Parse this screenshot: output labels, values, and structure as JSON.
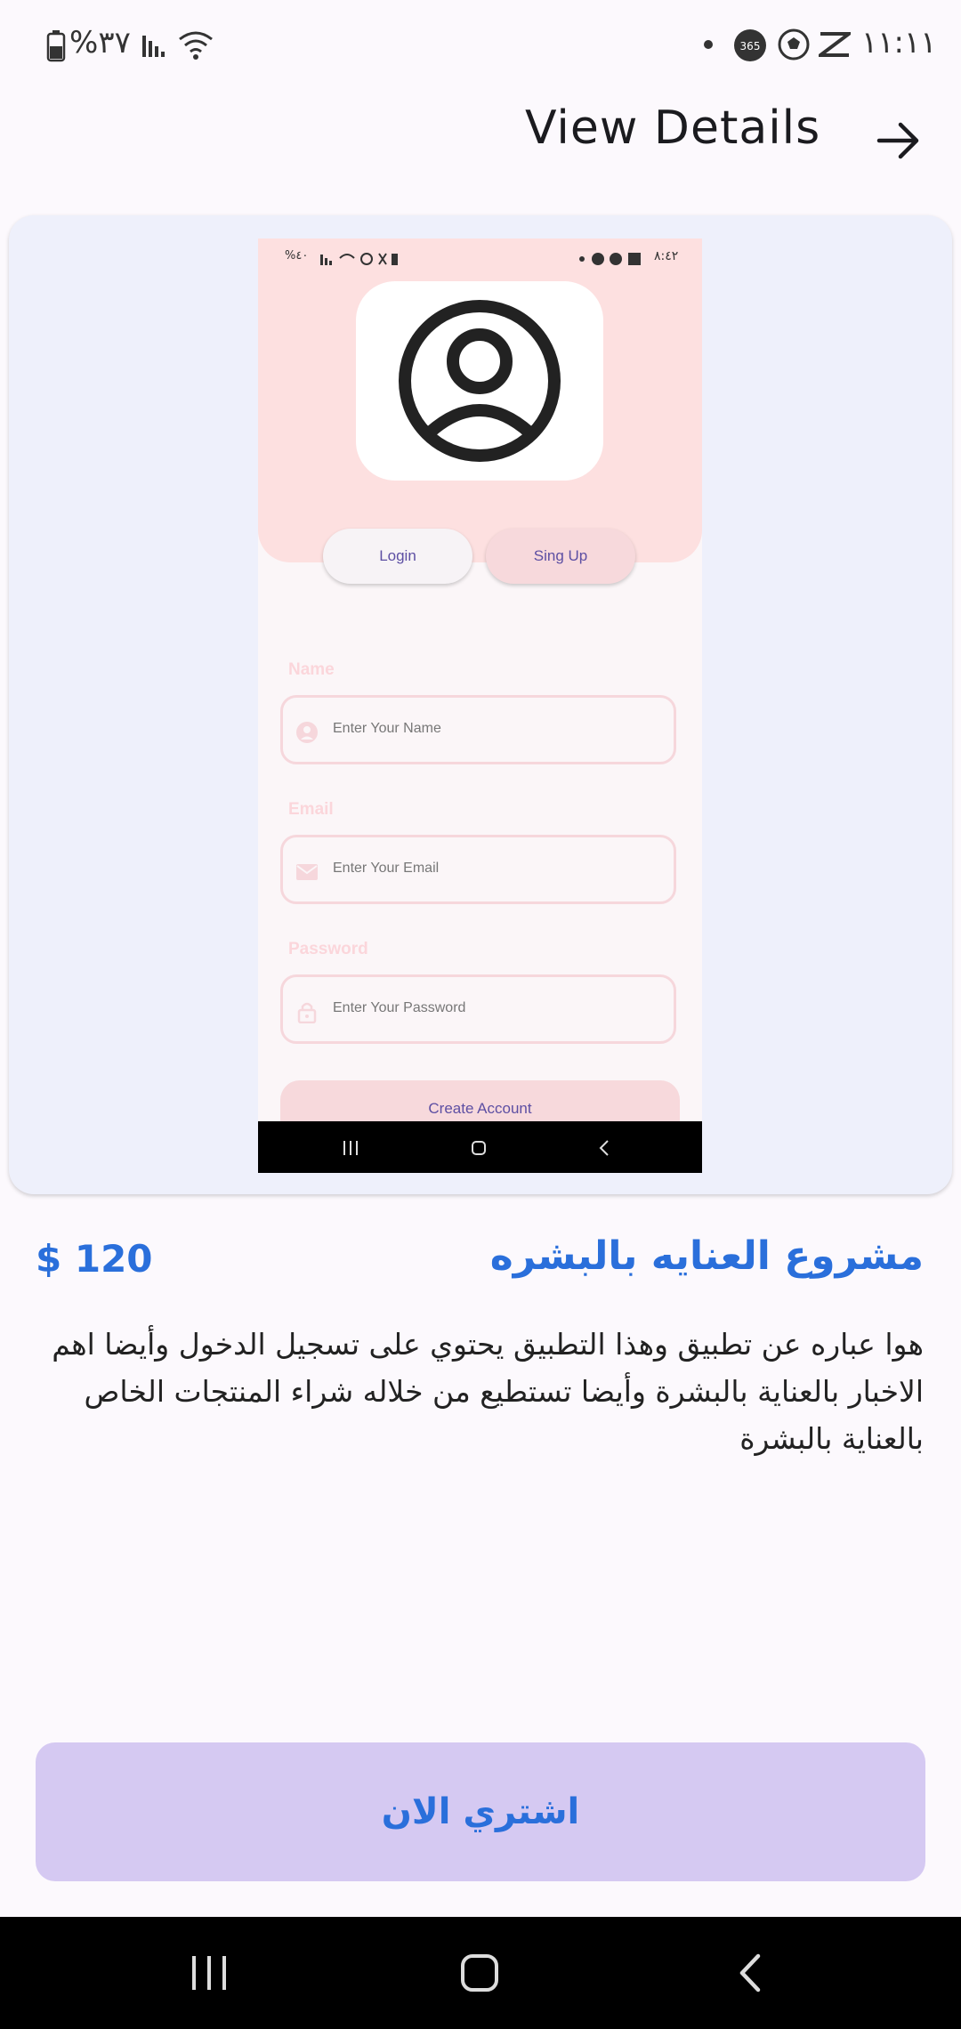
{
  "status_bar": {
    "time": "١١:١١",
    "battery": "%٣٧",
    "icons": [
      "battery-icon",
      "signal-icon",
      "wifi-icon",
      "dot-icon",
      "score-app-icon",
      "football-icon",
      "capcut-icon"
    ]
  },
  "header": {
    "title": "View Details",
    "back_icon": "arrow-right-icon"
  },
  "preview": {
    "mini_status": {
      "time": "٨:٤٢",
      "battery": "%٤٠"
    },
    "avatar_icon": "user-circle-icon",
    "tabs": {
      "login": "Login",
      "signup": "Sing Up"
    },
    "fields": [
      {
        "label": "Name",
        "placeholder": "Enter Your Name",
        "icon": "person-icon"
      },
      {
        "label": "Email",
        "placeholder": "Enter Your Email",
        "icon": "mail-icon"
      },
      {
        "label": "Password",
        "placeholder": "Enter Your Password",
        "icon": "lock-icon"
      }
    ],
    "create_button": "Create Account"
  },
  "product": {
    "title": "مشروع العنايه بالبشره",
    "price": "$ 120",
    "description": "هوا عباره عن تطبيق وهذا التطبيق يحتوي على تسجيل الدخول وأيضا اهم الاخبار بالعناية بالبشرة وأيضا  تستطيع من خلاله شراء المنتجات الخاص بالعناية بالبشرة"
  },
  "buy_button": "اشتري الان",
  "colors": {
    "accent": "#2a6fdb",
    "button_bg": "#d5c9f2",
    "card_bg": "#eef0fb",
    "preview_header": "#fde0e0"
  }
}
